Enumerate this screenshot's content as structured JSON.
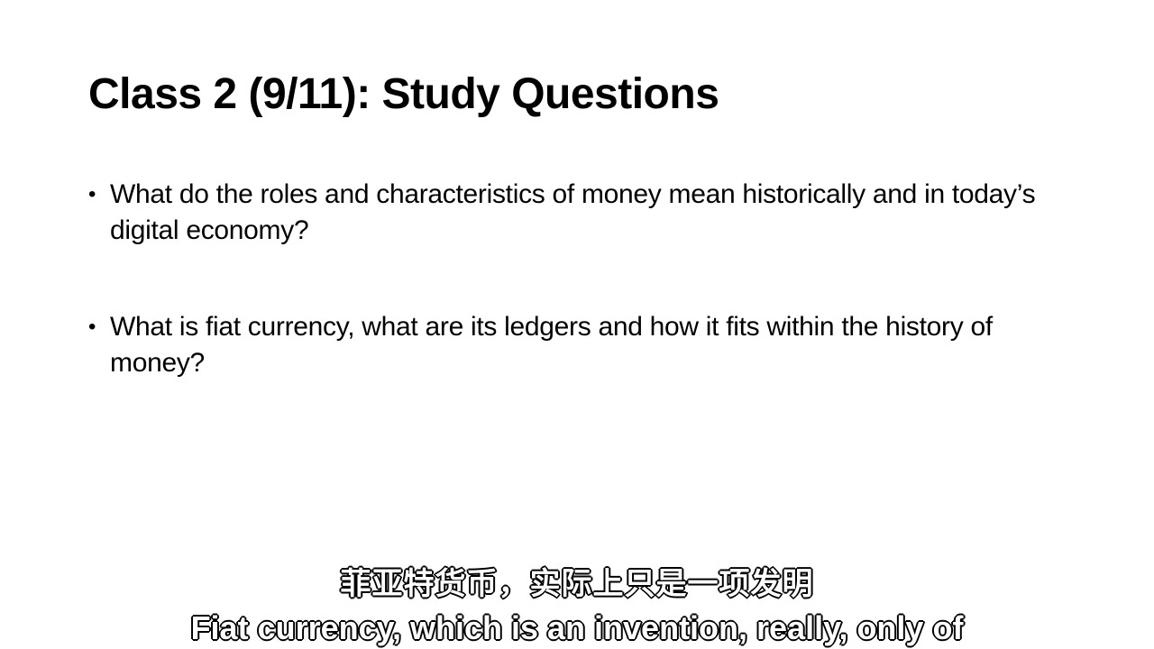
{
  "slide": {
    "title": "Class 2 (9/11): Study Questions",
    "bullet_symbol": "•",
    "bullets": [
      "What do the roles and characteristics of money mean historically and in today’s digital economy?",
      "What is fiat currency, what are its ledgers and how it fits within the history of money?"
    ]
  },
  "subtitles": {
    "chinese": "菲亚特货币，实际上只是一项发明",
    "english": "Fiat currency, which is an invention, really, only of"
  }
}
